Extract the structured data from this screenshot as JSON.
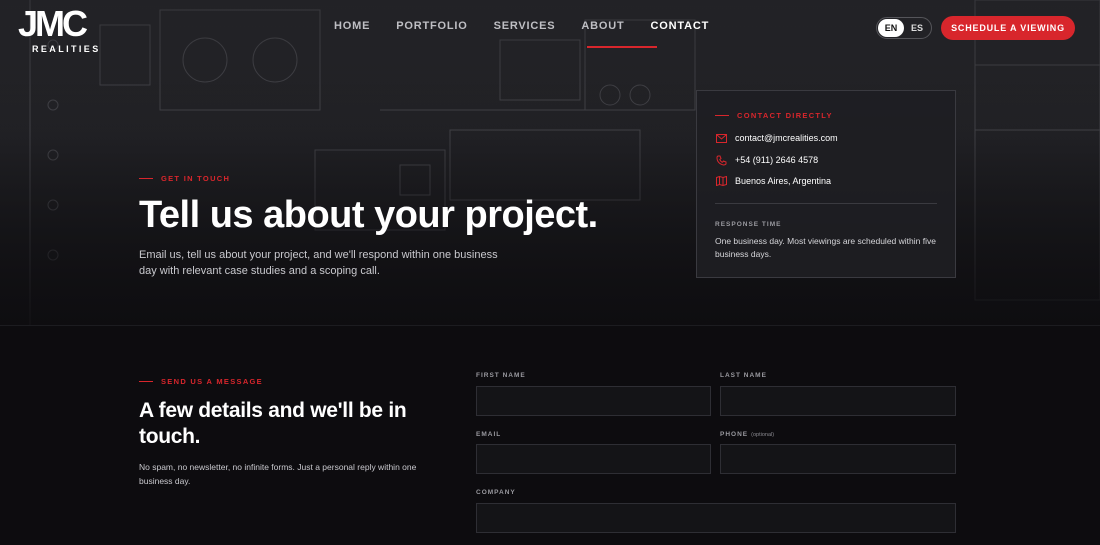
{
  "brand": {
    "logo_mark": "JMC",
    "logo_sub": "REALITIES"
  },
  "nav": {
    "items": [
      {
        "label": "HOME"
      },
      {
        "label": "PORTFOLIO"
      },
      {
        "label": "SERVICES"
      },
      {
        "label": "ABOUT"
      },
      {
        "label": "CONTACT",
        "active": true
      }
    ]
  },
  "language": {
    "options": [
      "EN",
      "ES"
    ],
    "selected": "EN"
  },
  "header_cta": {
    "label": "SCHEDULE A VIEWING"
  },
  "hero": {
    "eyebrow": "GET IN TOUCH",
    "title": "Tell us about your project.",
    "body": "Email us, tell us about your project, and we'll respond within one business day with relevant case studies and a scoping call."
  },
  "contact_card": {
    "eyebrow": "CONTACT DIRECTLY",
    "email": "contact@jmcrealities.com",
    "phone": "+54 (911) 2646 4578",
    "location": "Buenos Aires, Argentina",
    "response_label": "RESPONSE TIME",
    "response_text": "One business day. Most viewings are scheduled within five business days."
  },
  "form_section": {
    "eyebrow": "SEND US A MESSAGE",
    "title": "A few details and we'll be in touch.",
    "body": "No spam, no newsletter, no infinite forms. Just a personal reply within one business day.",
    "fields": {
      "first_name": {
        "label": "FIRST NAME",
        "value": ""
      },
      "last_name": {
        "label": "LAST NAME",
        "value": ""
      },
      "email": {
        "label": "EMAIL",
        "value": ""
      },
      "phone": {
        "label": "PHONE",
        "hint": "(optional)",
        "value": ""
      },
      "company": {
        "label": "COMPANY",
        "value": ""
      }
    }
  },
  "colors": {
    "accent": "#d8262c",
    "background": "#0d0c0f",
    "card": "#1e1e23"
  }
}
